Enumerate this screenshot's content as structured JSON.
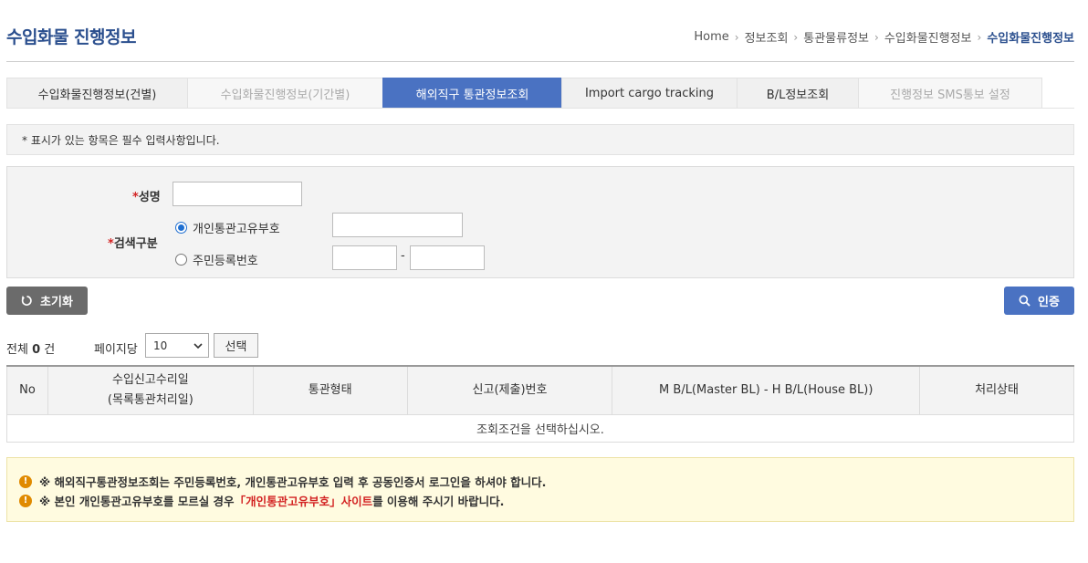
{
  "header": {
    "title": "수입화물 진행정보",
    "breadcrumb": [
      "Home",
      "정보조회",
      "통관물류정보",
      "수입화물진행정보",
      "수입화물진행정보"
    ]
  },
  "tabs": [
    {
      "label": "수입화물진행정보(건별)",
      "state": "normal"
    },
    {
      "label": "수입화물진행정보(기간별)",
      "state": "disabled"
    },
    {
      "label": "해외직구 통관정보조회",
      "state": "active"
    },
    {
      "label": "Import cargo tracking",
      "state": "normal"
    },
    {
      "label": "B/L정보조회",
      "state": "normal"
    },
    {
      "label": "진행정보 SMS통보 설정",
      "state": "disabled"
    }
  ],
  "notice": "* 표시가 있는 항목은 필수 입력사항입니다.",
  "form": {
    "required_mark": "*",
    "name_label": "성명",
    "name_value": "",
    "search_type_label": "검색구분",
    "option_customs_code": "개인통관고유부호",
    "option_resident_number": "주민등록번호",
    "selected_option": "개인통관고유부호",
    "customs_code_value": "",
    "resident_front_value": "",
    "resident_back_value": "",
    "resident_separator": "-"
  },
  "buttons": {
    "reset": "초기화",
    "auth": "인증",
    "select": "선택"
  },
  "result": {
    "total_prefix": "전체",
    "total_count": "0",
    "total_suffix": "건",
    "per_page_label": "페이지당",
    "per_page_value": "10"
  },
  "table": {
    "headers": [
      "No",
      "수입신고수리일",
      "(목록통관처리일)",
      "통관형태",
      "신고(제출)번호",
      "M B/L(Master BL) - H B/L(House BL))",
      "처리상태"
    ],
    "empty_message": "조회조건을 선택하십시오."
  },
  "warnings": {
    "line1": "※ 해외직구통관정보조회는 주민등록번호, 개인통관고유부호 입력 후 공동인증서 로그인을 하셔야 합니다.",
    "line2_prefix": "※ 본인 개인통관고유부호를 모르실 경우",
    "line2_link": "「개인통관고유부호」사이트",
    "line2_suffix": "를 이용해 주시기 바랍니다.",
    "icon_symbol": "!"
  },
  "colors": {
    "primary": "#4a72c2",
    "title": "#2b4f8e",
    "required": "#d32323",
    "warning_bg": "#fffbe0",
    "warning_icon": "#e08a00"
  }
}
